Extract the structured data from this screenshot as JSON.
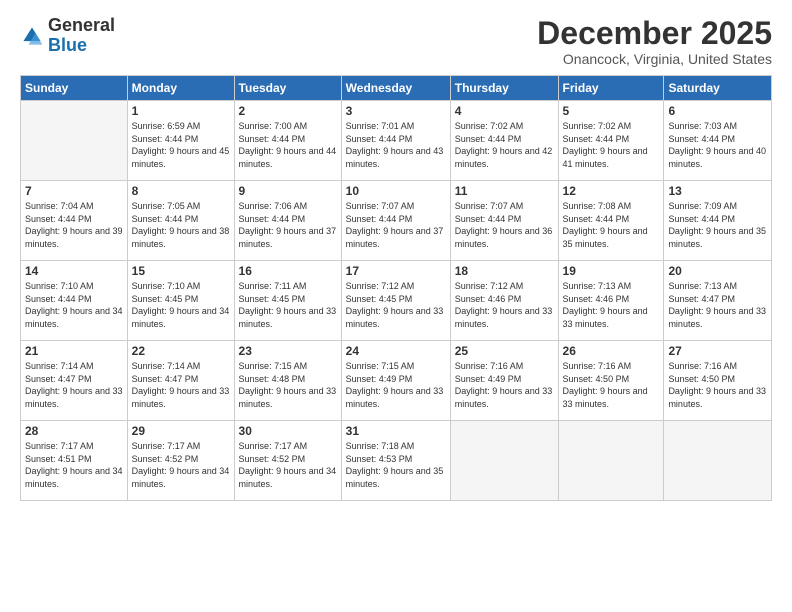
{
  "header": {
    "logo_general": "General",
    "logo_blue": "Blue",
    "month_title": "December 2025",
    "location": "Onancock, Virginia, United States"
  },
  "weekdays": [
    "Sunday",
    "Monday",
    "Tuesday",
    "Wednesday",
    "Thursday",
    "Friday",
    "Saturday"
  ],
  "weeks": [
    [
      {
        "day": "",
        "empty": true
      },
      {
        "day": "1",
        "sunrise": "Sunrise: 6:59 AM",
        "sunset": "Sunset: 4:44 PM",
        "daylight": "Daylight: 9 hours and 45 minutes."
      },
      {
        "day": "2",
        "sunrise": "Sunrise: 7:00 AM",
        "sunset": "Sunset: 4:44 PM",
        "daylight": "Daylight: 9 hours and 44 minutes."
      },
      {
        "day": "3",
        "sunrise": "Sunrise: 7:01 AM",
        "sunset": "Sunset: 4:44 PM",
        "daylight": "Daylight: 9 hours and 43 minutes."
      },
      {
        "day": "4",
        "sunrise": "Sunrise: 7:02 AM",
        "sunset": "Sunset: 4:44 PM",
        "daylight": "Daylight: 9 hours and 42 minutes."
      },
      {
        "day": "5",
        "sunrise": "Sunrise: 7:02 AM",
        "sunset": "Sunset: 4:44 PM",
        "daylight": "Daylight: 9 hours and 41 minutes."
      },
      {
        "day": "6",
        "sunrise": "Sunrise: 7:03 AM",
        "sunset": "Sunset: 4:44 PM",
        "daylight": "Daylight: 9 hours and 40 minutes."
      }
    ],
    [
      {
        "day": "7",
        "sunrise": "Sunrise: 7:04 AM",
        "sunset": "Sunset: 4:44 PM",
        "daylight": "Daylight: 9 hours and 39 minutes."
      },
      {
        "day": "8",
        "sunrise": "Sunrise: 7:05 AM",
        "sunset": "Sunset: 4:44 PM",
        "daylight": "Daylight: 9 hours and 38 minutes."
      },
      {
        "day": "9",
        "sunrise": "Sunrise: 7:06 AM",
        "sunset": "Sunset: 4:44 PM",
        "daylight": "Daylight: 9 hours and 37 minutes."
      },
      {
        "day": "10",
        "sunrise": "Sunrise: 7:07 AM",
        "sunset": "Sunset: 4:44 PM",
        "daylight": "Daylight: 9 hours and 37 minutes."
      },
      {
        "day": "11",
        "sunrise": "Sunrise: 7:07 AM",
        "sunset": "Sunset: 4:44 PM",
        "daylight": "Daylight: 9 hours and 36 minutes."
      },
      {
        "day": "12",
        "sunrise": "Sunrise: 7:08 AM",
        "sunset": "Sunset: 4:44 PM",
        "daylight": "Daylight: 9 hours and 35 minutes."
      },
      {
        "day": "13",
        "sunrise": "Sunrise: 7:09 AM",
        "sunset": "Sunset: 4:44 PM",
        "daylight": "Daylight: 9 hours and 35 minutes."
      }
    ],
    [
      {
        "day": "14",
        "sunrise": "Sunrise: 7:10 AM",
        "sunset": "Sunset: 4:44 PM",
        "daylight": "Daylight: 9 hours and 34 minutes."
      },
      {
        "day": "15",
        "sunrise": "Sunrise: 7:10 AM",
        "sunset": "Sunset: 4:45 PM",
        "daylight": "Daylight: 9 hours and 34 minutes."
      },
      {
        "day": "16",
        "sunrise": "Sunrise: 7:11 AM",
        "sunset": "Sunset: 4:45 PM",
        "daylight": "Daylight: 9 hours and 33 minutes."
      },
      {
        "day": "17",
        "sunrise": "Sunrise: 7:12 AM",
        "sunset": "Sunset: 4:45 PM",
        "daylight": "Daylight: 9 hours and 33 minutes."
      },
      {
        "day": "18",
        "sunrise": "Sunrise: 7:12 AM",
        "sunset": "Sunset: 4:46 PM",
        "daylight": "Daylight: 9 hours and 33 minutes."
      },
      {
        "day": "19",
        "sunrise": "Sunrise: 7:13 AM",
        "sunset": "Sunset: 4:46 PM",
        "daylight": "Daylight: 9 hours and 33 minutes."
      },
      {
        "day": "20",
        "sunrise": "Sunrise: 7:13 AM",
        "sunset": "Sunset: 4:47 PM",
        "daylight": "Daylight: 9 hours and 33 minutes."
      }
    ],
    [
      {
        "day": "21",
        "sunrise": "Sunrise: 7:14 AM",
        "sunset": "Sunset: 4:47 PM",
        "daylight": "Daylight: 9 hours and 33 minutes."
      },
      {
        "day": "22",
        "sunrise": "Sunrise: 7:14 AM",
        "sunset": "Sunset: 4:47 PM",
        "daylight": "Daylight: 9 hours and 33 minutes."
      },
      {
        "day": "23",
        "sunrise": "Sunrise: 7:15 AM",
        "sunset": "Sunset: 4:48 PM",
        "daylight": "Daylight: 9 hours and 33 minutes."
      },
      {
        "day": "24",
        "sunrise": "Sunrise: 7:15 AM",
        "sunset": "Sunset: 4:49 PM",
        "daylight": "Daylight: 9 hours and 33 minutes."
      },
      {
        "day": "25",
        "sunrise": "Sunrise: 7:16 AM",
        "sunset": "Sunset: 4:49 PM",
        "daylight": "Daylight: 9 hours and 33 minutes."
      },
      {
        "day": "26",
        "sunrise": "Sunrise: 7:16 AM",
        "sunset": "Sunset: 4:50 PM",
        "daylight": "Daylight: 9 hours and 33 minutes."
      },
      {
        "day": "27",
        "sunrise": "Sunrise: 7:16 AM",
        "sunset": "Sunset: 4:50 PM",
        "daylight": "Daylight: 9 hours and 33 minutes."
      }
    ],
    [
      {
        "day": "28",
        "sunrise": "Sunrise: 7:17 AM",
        "sunset": "Sunset: 4:51 PM",
        "daylight": "Daylight: 9 hours and 34 minutes."
      },
      {
        "day": "29",
        "sunrise": "Sunrise: 7:17 AM",
        "sunset": "Sunset: 4:52 PM",
        "daylight": "Daylight: 9 hours and 34 minutes."
      },
      {
        "day": "30",
        "sunrise": "Sunrise: 7:17 AM",
        "sunset": "Sunset: 4:52 PM",
        "daylight": "Daylight: 9 hours and 34 minutes."
      },
      {
        "day": "31",
        "sunrise": "Sunrise: 7:18 AM",
        "sunset": "Sunset: 4:53 PM",
        "daylight": "Daylight: 9 hours and 35 minutes."
      },
      {
        "day": "",
        "empty": true
      },
      {
        "day": "",
        "empty": true
      },
      {
        "day": "",
        "empty": true
      }
    ]
  ]
}
